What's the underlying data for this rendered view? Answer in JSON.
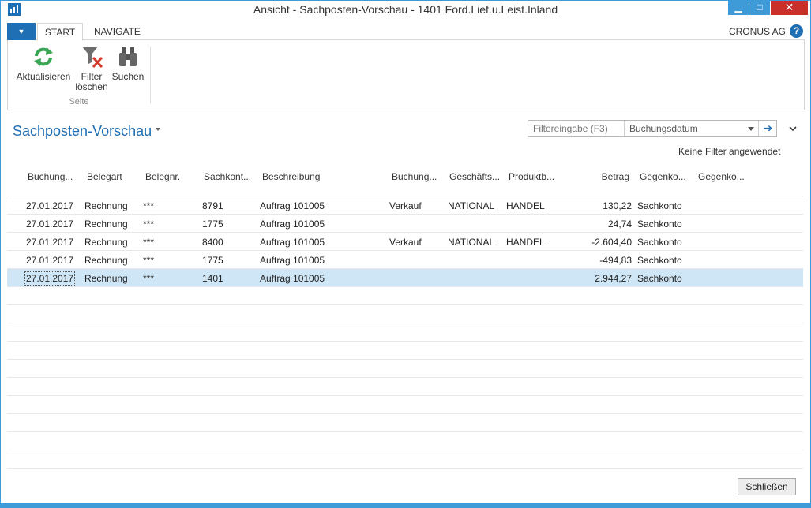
{
  "window": {
    "title": "Ansicht - Sachposten-Vorschau - 1401 Ford.Lief.u.Leist.Inland",
    "minimize_glyph": "▁",
    "maximize_glyph": "□",
    "close_glyph": "✕"
  },
  "ribbon_tabs": {
    "file_glyph": "▼",
    "start": "START",
    "navigate": "NAVIGATE",
    "company": "CRONUS AG",
    "help_glyph": "?"
  },
  "ribbon": {
    "refresh_label": "Aktualisieren",
    "clear_filter_label_1": "Filter",
    "clear_filter_label_2": "löschen",
    "search_label": "Suchen",
    "group_label": "Seite",
    "icons": {
      "refresh": "refresh-icon",
      "clear_filter": "clear-filter-icon",
      "search": "binoculars-icon"
    }
  },
  "page": {
    "title": "Sachposten-Vorschau",
    "filter_placeholder": "Filtereingabe (F3)",
    "filter_field": "Buchungsdatum",
    "filter_go_glyph": "➔",
    "no_filter_text": "Keine Filter angewendet"
  },
  "table": {
    "columns": [
      "Buchung...",
      "Belegart",
      "Belegnr.",
      "Sachkont...",
      "Beschreibung",
      "Buchung...",
      "Geschäfts...",
      "Produktb...",
      "Betrag",
      "Gegenko...",
      "Gegenko..."
    ],
    "rows": [
      [
        "27.01.2017",
        "Rechnung",
        "***",
        "8791",
        "Auftrag 101005",
        "Verkauf",
        "NATIONAL",
        "HANDEL",
        "130,22",
        "Sachkonto",
        ""
      ],
      [
        "27.01.2017",
        "Rechnung",
        "***",
        "1775",
        "Auftrag 101005",
        "",
        "",
        "",
        "24,74",
        "Sachkonto",
        ""
      ],
      [
        "27.01.2017",
        "Rechnung",
        "***",
        "8400",
        "Auftrag 101005",
        "Verkauf",
        "NATIONAL",
        "HANDEL",
        "-2.604,40",
        "Sachkonto",
        ""
      ],
      [
        "27.01.2017",
        "Rechnung",
        "***",
        "1775",
        "Auftrag 101005",
        "",
        "",
        "",
        "-494,83",
        "Sachkonto",
        ""
      ],
      [
        "27.01.2017",
        "Rechnung",
        "***",
        "1401",
        "Auftrag 101005",
        "",
        "",
        "",
        "2.944,27",
        "Sachkonto",
        ""
      ]
    ],
    "selected_row": 4
  },
  "footer": {
    "close_label": "Schließen"
  },
  "colors": {
    "accent": "#1f6fb5",
    "window_border": "#3f9bd8",
    "close_red": "#c9302c",
    "selected_row": "#cfe6f6"
  }
}
